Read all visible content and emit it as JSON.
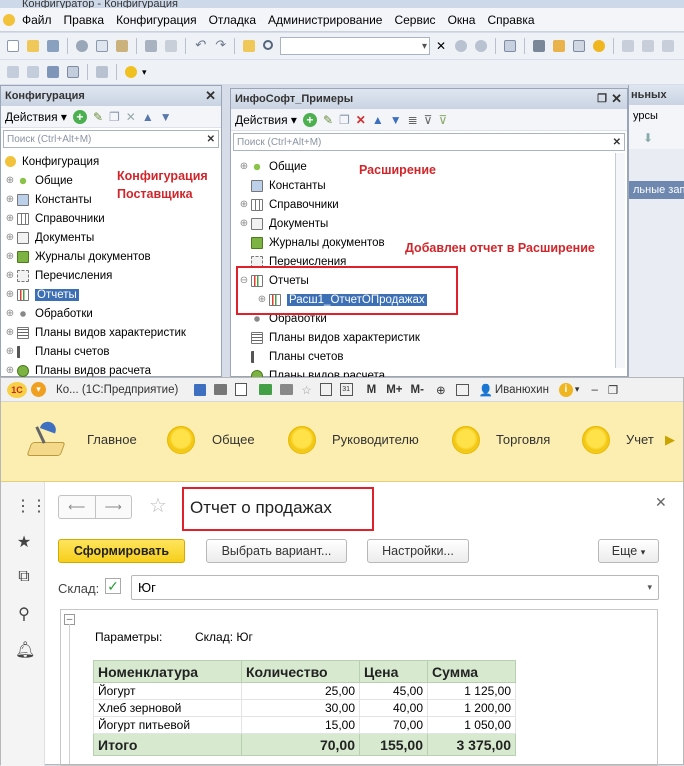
{
  "configurator": {
    "title": "Конфигуратор - Конфигурация",
    "menu": [
      "Файл",
      "Правка",
      "Конфигурация",
      "Отладка",
      "Администрирование",
      "Сервис",
      "Окна",
      "Справка"
    ],
    "search_value": ""
  },
  "config_panel": {
    "title": "Конфигурация",
    "actions_label": "Действия",
    "search_placeholder": "Поиск (Ctrl+Alt+M)",
    "root": "Конфигурация",
    "items": [
      "Общие",
      "Константы",
      "Справочники",
      "Документы",
      "Журналы документов",
      "Перечисления",
      "Отчеты",
      "Обработки",
      "Планы видов характеристик",
      "Планы счетов",
      "Планы видов расчета"
    ],
    "annotation": "Конфигурация\nПоставщика"
  },
  "ext_panel": {
    "title": "ИнфоСофт_Примеры",
    "actions_label": "Действия",
    "search_placeholder": "Поиск (Ctrl+Alt+M)",
    "items": [
      "Общие",
      "Константы",
      "Справочники",
      "Документы",
      "Журналы документов",
      "Перечисления",
      "Отчеты",
      "Обработки",
      "Планы видов характеристик",
      "Планы счетов",
      "Планы видов расчета"
    ],
    "report_child": "Расш1_ОтчетОПродажах",
    "annotation_ext": "Расширение",
    "annotation_added": "Добавлен отчет в Расширение"
  },
  "back_panel": {
    "title": "ньных",
    "tab": "урсы",
    "row": "льные запи"
  },
  "enterprise": {
    "title": "Ко... (1С:Предприятие)",
    "memory_buttons": [
      "M",
      "M+",
      "M-"
    ],
    "user": "Иванюхин",
    "sections": [
      "Главное",
      "Общее",
      "Руководителю",
      "Торговля",
      "Учет"
    ]
  },
  "report": {
    "title": "Отчет о продажах",
    "generate_label": "Сформировать",
    "choose_variant_label": "Выбрать вариант...",
    "settings_label": "Настройки...",
    "more_label": "Еще",
    "warehouse_label": "Склад:",
    "warehouse_value": "Юг",
    "params_label": "Параметры:",
    "params_value": "Склад: Юг",
    "columns": [
      "Номенклатура",
      "Количество",
      "Цена",
      "Сумма"
    ],
    "rows": [
      [
        "Йогурт",
        "25,00",
        "45,00",
        "1 125,00"
      ],
      [
        "Хлеб зерновой",
        "30,00",
        "40,00",
        "1 200,00"
      ],
      [
        "Йогурт питьевой",
        "15,00",
        "70,00",
        "1 050,00"
      ]
    ],
    "total": [
      "Итого",
      "70,00",
      "155,00",
      "3 375,00"
    ]
  }
}
